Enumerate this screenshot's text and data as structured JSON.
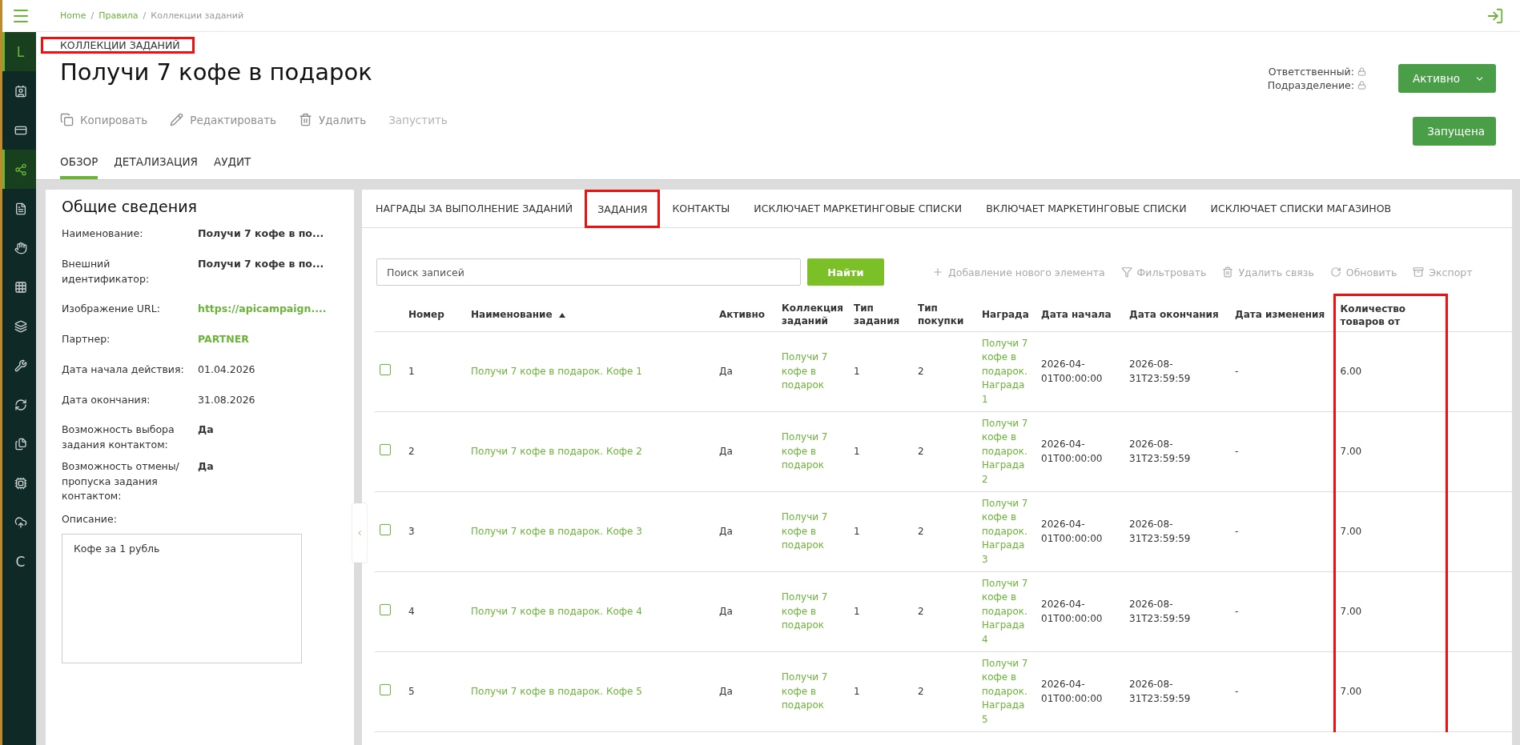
{
  "sidebar": {
    "items": [
      {
        "kind": "icon",
        "selected": false
      },
      {
        "kind": "letter",
        "label": "L",
        "selected": true
      },
      {
        "kind": "icon",
        "selected": false
      },
      {
        "kind": "icon",
        "selected": false
      },
      {
        "kind": "icon",
        "selected": true
      },
      {
        "kind": "icon",
        "selected": false
      },
      {
        "kind": "icon",
        "selected": false
      },
      {
        "kind": "icon",
        "selected": false
      },
      {
        "kind": "icon",
        "selected": false
      },
      {
        "kind": "icon",
        "selected": false
      },
      {
        "kind": "icon",
        "selected": false
      },
      {
        "kind": "icon",
        "selected": false
      },
      {
        "kind": "icon",
        "selected": false
      },
      {
        "kind": "icon",
        "selected": false
      },
      {
        "kind": "letter",
        "label": "C",
        "selected": false
      }
    ]
  },
  "breadcrumbs": [
    {
      "label": "Home",
      "link": true
    },
    {
      "separator": "/",
      "label": "Правила",
      "link": true
    },
    {
      "separator": "/",
      "label": "Коллекции заданий",
      "link": false
    }
  ],
  "section_label": {
    "text": "КОЛЛЕКЦИИ ЗАДАНИЙ",
    "highlighted": true
  },
  "title": "Получи 7 кофе в подарок",
  "meta": [
    "Ответственный:",
    "Подразделение:"
  ],
  "status_button": "Активно",
  "actions": [
    {
      "label": "Копировать",
      "disabled": false
    },
    {
      "label": "Редактировать",
      "disabled": false
    },
    {
      "label": "Удалить",
      "disabled": false
    },
    {
      "label": "Запустить",
      "disabled": true
    }
  ],
  "state_button": "Запущена",
  "page_tabs": [
    {
      "label": "ОБЗОР",
      "selected": true
    },
    {
      "label": "ДЕТАЛИЗАЦИЯ",
      "selected": false
    },
    {
      "label": "АУДИТ",
      "selected": false
    }
  ],
  "info": {
    "heading": "Общие сведения",
    "fields": [
      {
        "label": "Наименование:",
        "value": "Получи 7 кофе в по...",
        "kind": "bold"
      },
      {
        "label": "Внешний идентификатор:",
        "value": "Получи 7 кофе в по...",
        "kind": "bold"
      },
      {
        "label": "Изображение URL:",
        "value": "https://apicampaign....",
        "kind": "link"
      },
      {
        "label": "Партнер:",
        "value": "PARTNER",
        "kind": "link"
      },
      {
        "label": "Дата начала действия:",
        "value": "01.04.2026",
        "kind": "plain"
      },
      {
        "label": "Дата окончания:",
        "value": "31.08.2026",
        "kind": "plain"
      },
      {
        "label": "Возможность выбора задания контактом:",
        "value": "Да",
        "kind": "bold"
      },
      {
        "label": "Возможность отмены/ пропуска задания контактом:",
        "value": "Да",
        "kind": "bold"
      }
    ],
    "description_label": "Описание:",
    "description": "Кофе за 1 рубль"
  },
  "detail_tabs": [
    {
      "label": "НАГРАДЫ ЗА ВЫПОЛНЕНИЕ ЗАДАНИЙ",
      "selected": false,
      "highlighted": false
    },
    {
      "label": "ЗАДАНИЯ",
      "selected": true,
      "highlighted": true
    },
    {
      "label": "КОНТАКТЫ",
      "selected": false,
      "highlighted": false
    },
    {
      "label": "ИСКЛЮЧАЕТ МАРКЕТИНГОВЫЕ СПИСКИ",
      "selected": false,
      "highlighted": false
    },
    {
      "label": "ВКЛЮЧАЕТ МАРКЕТИНГОВЫЕ СПИСКИ",
      "selected": false,
      "highlighted": false
    },
    {
      "label": "ИСКЛЮЧАЕТ СПИСКИ МАГАЗИНОВ",
      "selected": false,
      "highlighted": false
    }
  ],
  "search": {
    "placeholder": "Поиск записей",
    "button": "Найти"
  },
  "toolbar": [
    {
      "label": "Добавление нового элемента"
    },
    {
      "label": "Фильтровать"
    },
    {
      "label": "Удалить связь"
    },
    {
      "label": "Обновить"
    },
    {
      "label": "Экспорт"
    }
  ],
  "table": {
    "columns": [
      {
        "label": "Номер",
        "sorted": false,
        "highlighted": false
      },
      {
        "label": "Наименование",
        "sorted": true,
        "highlighted": false
      },
      {
        "label": "Активно",
        "sorted": false,
        "highlighted": false
      },
      {
        "label": "Коллекция заданий",
        "sorted": false,
        "highlighted": false
      },
      {
        "label": "Тип задания",
        "sorted": false,
        "highlighted": false
      },
      {
        "label": "Тип покупки",
        "sorted": false,
        "highlighted": false
      },
      {
        "label": "Награда",
        "sorted": false,
        "highlighted": false
      },
      {
        "label": "Дата начала",
        "sorted": false,
        "highlighted": false
      },
      {
        "label": "Дата окончания",
        "sorted": false,
        "highlighted": false
      },
      {
        "label": "Дата изменения",
        "sorted": false,
        "highlighted": false
      },
      {
        "label": "Количество товаров от",
        "sorted": false,
        "highlighted": true
      }
    ],
    "rows": [
      {
        "checked": false,
        "cells": [
          "1",
          "Получи 7 кофе в подарок. Кофе 1",
          "Да",
          "Получи 7 кофе в подарок",
          "1",
          "2",
          "Получи 7 кофе в подарок. Награда 1",
          "2026-04-01T00:00:00",
          "2026-08-31T23:59:59",
          "-",
          "6.00"
        ]
      },
      {
        "checked": false,
        "cells": [
          "2",
          "Получи 7 кофе в подарок. Кофе 2",
          "Да",
          "Получи 7 кофе в подарок",
          "1",
          "2",
          "Получи 7 кофе в подарок. Награда 2",
          "2026-04-01T00:00:00",
          "2026-08-31T23:59:59",
          "-",
          "7.00"
        ]
      },
      {
        "checked": false,
        "cells": [
          "3",
          "Получи 7 кофе в подарок. Кофе 3",
          "Да",
          "Получи 7 кофе в подарок",
          "1",
          "2",
          "Получи 7 кофе в подарок. Награда 3",
          "2026-04-01T00:00:00",
          "2026-08-31T23:59:59",
          "-",
          "7.00"
        ]
      },
      {
        "checked": false,
        "cells": [
          "4",
          "Получи 7 кофе в подарок. Кофе 4",
          "Да",
          "Получи 7 кофе в подарок",
          "1",
          "2",
          "Получи 7 кофе в подарок. Награда 4",
          "2026-04-01T00:00:00",
          "2026-08-31T23:59:59",
          "-",
          "7.00"
        ]
      },
      {
        "checked": false,
        "cells": [
          "5",
          "Получи 7 кофе в подарок. Кофе 5",
          "Да",
          "Получи 7 кофе в подарок",
          "1",
          "2",
          "Получи 7 кофе в подарок. Награда 5",
          "2026-04-01T00:00:00",
          "2026-08-31T23:59:59",
          "-",
          "7.00"
        ]
      }
    ]
  }
}
